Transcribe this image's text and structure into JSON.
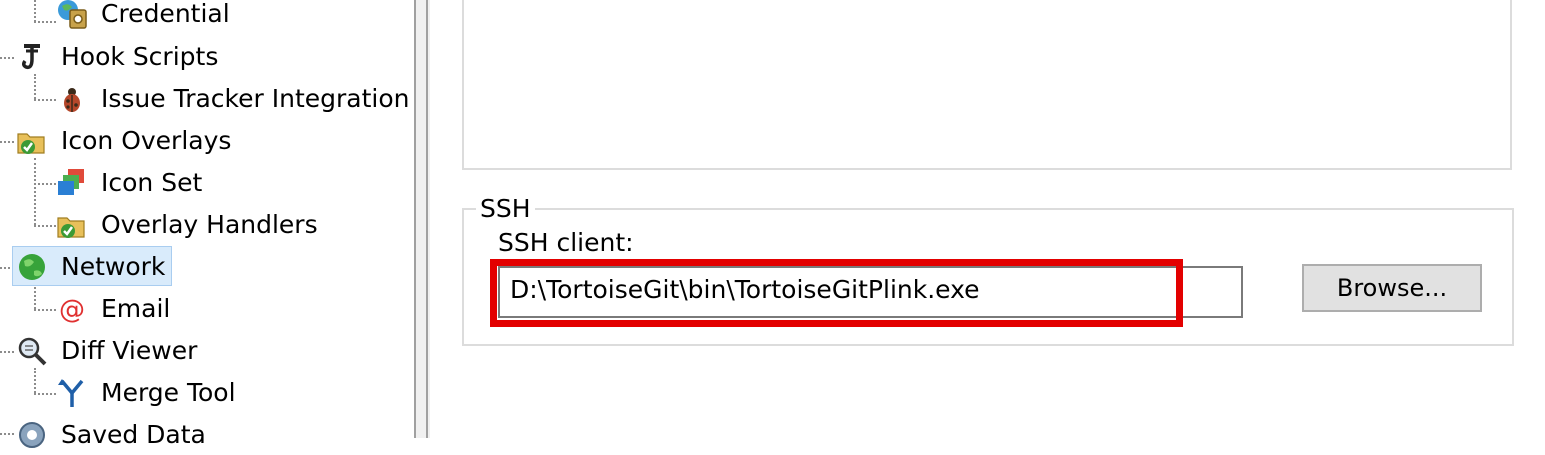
{
  "tree": {
    "items": [
      {
        "label": "Credential",
        "icon": "credential-icon"
      },
      {
        "label": "Hook Scripts",
        "icon": "hook-icon"
      },
      {
        "label": "Issue Tracker Integration",
        "icon": "bug-icon"
      },
      {
        "label": "Icon Overlays",
        "icon": "folder-check-icon"
      },
      {
        "label": "Icon Set",
        "icon": "icon-set-icon"
      },
      {
        "label": "Overlay Handlers",
        "icon": "folder-check-icon"
      },
      {
        "label": "Network",
        "icon": "globe-icon",
        "selected": true
      },
      {
        "label": "Email",
        "icon": "at-icon"
      },
      {
        "label": "Diff Viewer",
        "icon": "magnifier-icon"
      },
      {
        "label": "Merge Tool",
        "icon": "merge-icon"
      },
      {
        "label": "Saved Data",
        "icon": "gear-icon"
      }
    ]
  },
  "ssh": {
    "group_label": "SSH",
    "client_label": "SSH client:",
    "client_value": "D:\\TortoiseGit\\bin\\TortoiseGitPlink.exe",
    "browse_label": "Browse..."
  },
  "colors": {
    "highlight": "#e30000",
    "selection": "#d9ebfb"
  }
}
